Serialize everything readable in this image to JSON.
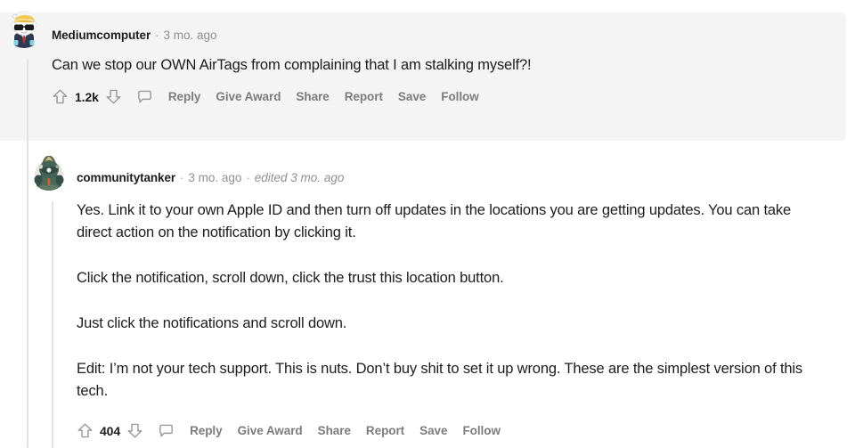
{
  "theme": {
    "page_background": "#ffffff",
    "highlight_background": "#f4f4f4",
    "text_color": "#1c1c1c",
    "muted_text_color": "#909090",
    "action_text_color": "#7c7c7c",
    "thread_line_color": "#e2e2e2"
  },
  "comments": [
    {
      "id": "comment-mediumcomputer",
      "highlighted": true,
      "author": "Mediumcomputer",
      "separator": "·",
      "timestamp": "3 mo. ago",
      "edited": "",
      "avatar": {
        "name": "avatar-snoo-sunglasses",
        "hair_color": "#f2c94c",
        "body_color": "#ffffff",
        "suit_color": "#2b3a52",
        "tie_color": "#c0392b",
        "glasses_color": "#1a1a1a",
        "shirt_accent": "#7fd4e8"
      },
      "paragraphs": [
        "Can we stop our OWN AirTags from complaining that I am stalking myself?!"
      ],
      "actions": {
        "upvote_icon": "upvote-arrow-icon",
        "vote_count": "1.2k",
        "downvote_icon": "downvote-arrow-icon",
        "comment_icon": "comment-bubble-icon",
        "links": [
          "Reply",
          "Give Award",
          "Share",
          "Report",
          "Save",
          "Follow"
        ]
      }
    },
    {
      "id": "comment-communitytanker",
      "highlighted": false,
      "author": "communitytanker",
      "separator": "·",
      "timestamp": "3 mo. ago",
      "edited": "edited 3 mo. ago",
      "avatar": {
        "name": "avatar-military-character",
        "base_color": "#3c5b55",
        "helmet_color": "#556b4a",
        "accent_color": "#c8b88a",
        "highlight_color": "#e8e2cf",
        "detail_color": "#d4622a"
      },
      "paragraphs": [
        "Yes. Link it to your own Apple ID and then turn off updates in the locations you are getting updates. You can take direct action on the notification by clicking it.",
        "Click the notification, scroll down, click the trust this location button.",
        "Just click the notifications and scroll down.",
        "Edit: I’m not your tech support. This is nuts. Don’t buy shit to set it up wrong. These are the simplest version of this tech."
      ],
      "actions": {
        "upvote_icon": "upvote-arrow-icon",
        "vote_count": "404",
        "downvote_icon": "downvote-arrow-icon",
        "comment_icon": "comment-bubble-icon",
        "links": [
          "Reply",
          "Give Award",
          "Share",
          "Report",
          "Save",
          "Follow"
        ]
      }
    }
  ]
}
